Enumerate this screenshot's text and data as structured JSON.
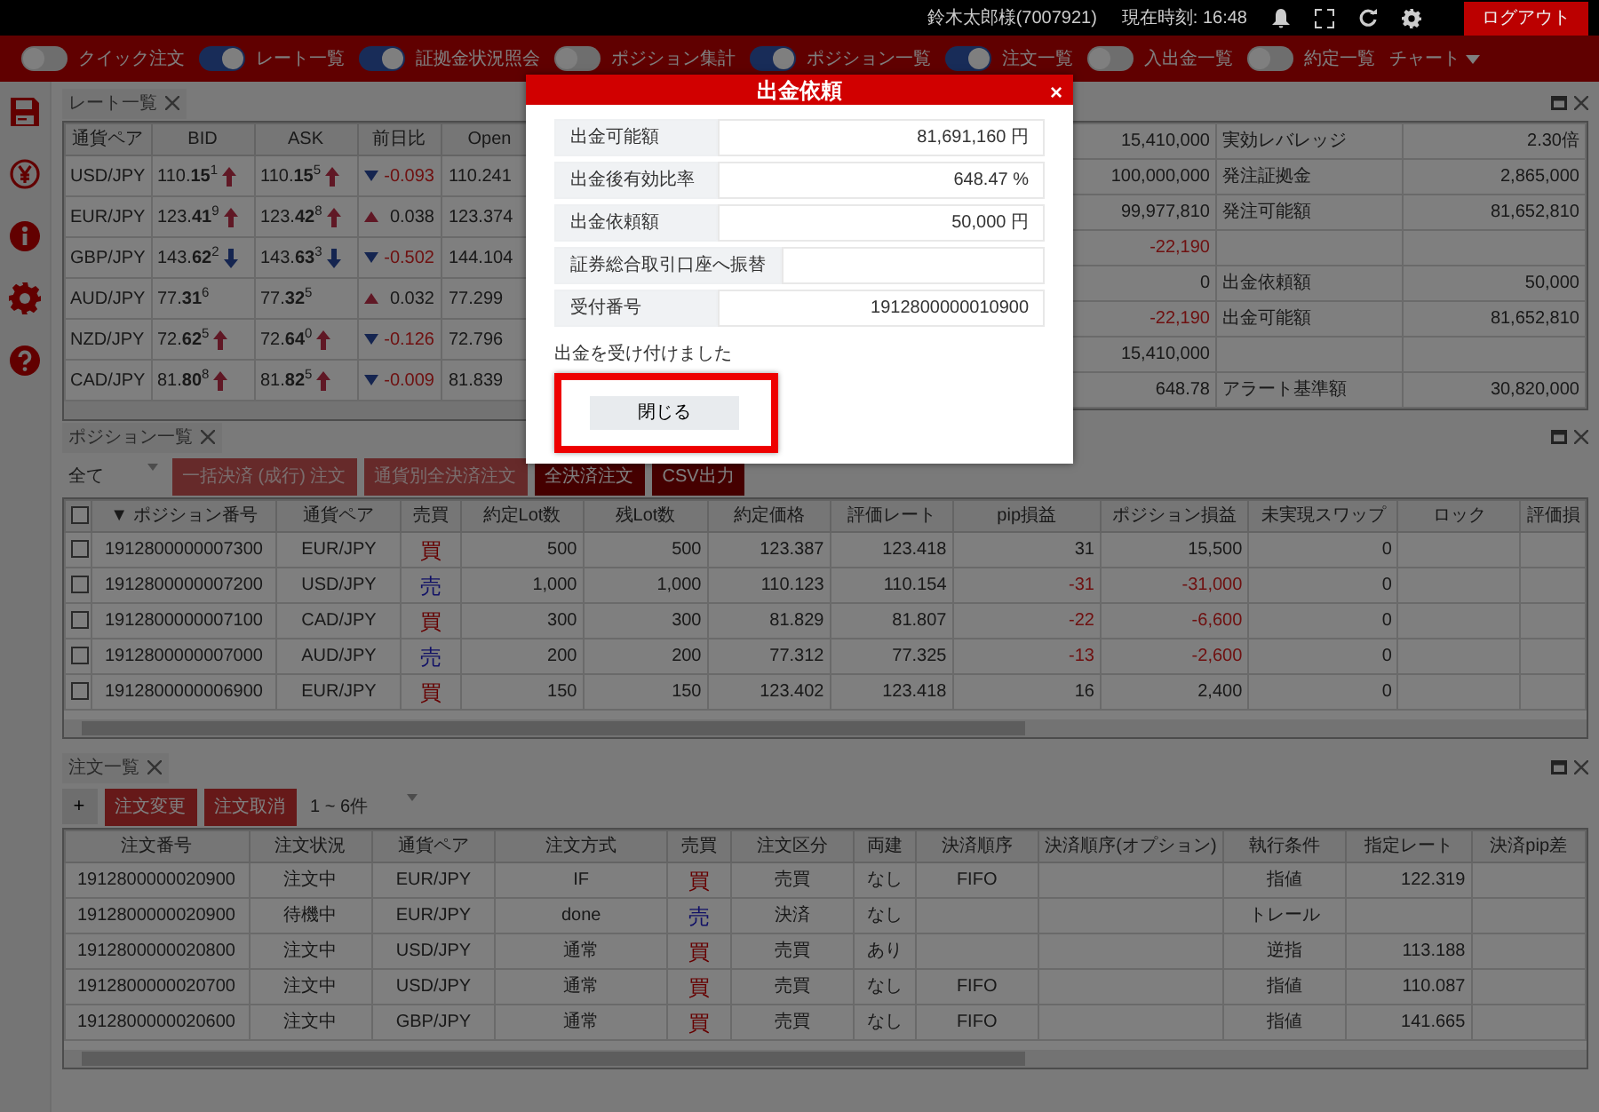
{
  "top_bar": {
    "user": "鈴木太郎様(7007921)",
    "clock": "現在時刻: 16:48",
    "logout": "ログアウト"
  },
  "toolbar": {
    "toggles": [
      {
        "label": "クイック注文",
        "on": false
      },
      {
        "label": "レート一覧",
        "on": true
      },
      {
        "label": "証拠金状況照会",
        "on": true
      },
      {
        "label": "ポジション集計",
        "on": false
      },
      {
        "label": "ポジション一覧",
        "on": true
      },
      {
        "label": "注文一覧",
        "on": true
      },
      {
        "label": "入出金一覧",
        "on": false
      },
      {
        "label": "約定一覧",
        "on": false
      }
    ],
    "menu": "チャート"
  },
  "rate_panel": {
    "tab": "レート一覧",
    "columns": [
      "通貨ペア",
      "BID",
      "ASK",
      "前日比",
      "Open"
    ],
    "rows": [
      {
        "pair": "USD/JPY",
        "bid": {
          "text": "110.**15**$^{1}$",
          "kind": "up"
        },
        "ask": {
          "text": "110.**15**$^{5}$",
          "kind": "up"
        },
        "change": {
          "text": "-0.093",
          "kind": "down"
        },
        "open": "110.241"
      },
      {
        "pair": "EUR/JPY",
        "bid": {
          "text": "123.**41**$^{9}$",
          "kind": "up"
        },
        "ask": {
          "text": "123.**42**$^{8}$",
          "kind": "up"
        },
        "change": {
          "text": "0.038",
          "kind": "up"
        },
        "open": "123.374"
      },
      {
        "pair": "GBP/JPY",
        "bid": {
          "text": "143.**62**$^{2}$",
          "kind": "down"
        },
        "ask": {
          "text": "143.**63**$^{3}$",
          "kind": "down"
        },
        "change": {
          "text": "-0.502",
          "kind": "down"
        },
        "open": "144.104"
      },
      {
        "pair": "AUD/JPY",
        "bid": {
          "text": "77.**31**$^{6}$",
          "kind": "flat"
        },
        "ask": {
          "text": "77.**32**$^{5}$",
          "kind": "flat"
        },
        "change": {
          "text": "0.032",
          "kind": "up"
        },
        "open": "77.299"
      },
      {
        "pair": "NZD/JPY",
        "bid": {
          "text": "72.**62**$^{5}$",
          "kind": "up"
        },
        "ask": {
          "text": "72.**64**$^{0}$",
          "kind": "up"
        },
        "change": {
          "text": "-0.126",
          "kind": "down"
        },
        "open": "72.796"
      },
      {
        "pair": "CAD/JPY",
        "bid": {
          "text": "81.**80**$^{8}$",
          "kind": "up"
        },
        "ask": {
          "text": "81.**82**$^{5}$",
          "kind": "up"
        },
        "change": {
          "text": "-0.009",
          "kind": "down"
        },
        "open": "81.839"
      }
    ]
  },
  "margin_panel": {
    "rows": [
      {
        "value": "15,410,000",
        "loss": false,
        "label": "実効レバレッジ",
        "value_2": "2.30倍"
      },
      {
        "value": "100,000,000",
        "loss": false,
        "label": "発注証拠金",
        "value_2": "2,865,000"
      },
      {
        "value": "99,977,810",
        "loss": false,
        "label": "発注可能額",
        "value_2": "81,652,810"
      },
      {
        "value": "-22,190",
        "loss": true
      },
      {
        "value": "0",
        "loss": false,
        "label": "出金依頼額",
        "value_2": "50,000"
      },
      {
        "value": "-22,190",
        "loss": true,
        "label": "出金可能額",
        "value_2": "81,652,810"
      },
      {
        "value": "15,410,000",
        "loss": false
      },
      {
        "value": "648.78",
        "loss": false,
        "label": "アラート基準額",
        "value_2": "30,820,000"
      }
    ]
  },
  "position_panel": {
    "tab": "ポジション一覧",
    "filter": "全て",
    "buttons": [
      {
        "label": "一括決済 (成行) 注文",
        "disabled": true
      },
      {
        "label": "通貨別全決済注文",
        "disabled": true
      },
      {
        "label": "全決済注文",
        "disabled": false
      },
      {
        "label": "CSV出力",
        "disabled": false
      }
    ],
    "select_all_checked": false,
    "columns": [
      "▼ ポジション番号",
      "通貨ペア",
      "売買",
      "約定Lot数",
      "残Lot数",
      "約定価格",
      "評価レート",
      "pip損益",
      "ポジション損益",
      "未実現スワップ",
      "ロック",
      "評価損"
    ],
    "rows": [
      {
        "checked": false,
        "number": "1912800000007300",
        "pair": "EUR/JPY",
        "side": {
          "text": "買",
          "kind": "buy"
        },
        "lots": "500",
        "remaining": "500",
        "price": "123.387",
        "rate": "123.418",
        "pips": "31",
        "pnl": "15,500",
        "loss": false,
        "swap": "0"
      },
      {
        "checked": false,
        "number": "1912800000007200",
        "pair": "USD/JPY",
        "side": {
          "text": "売",
          "kind": "sell"
        },
        "lots": "1,000",
        "remaining": "1,000",
        "price": "110.123",
        "rate": "110.154",
        "pips": "-31",
        "pnl": "-31,000",
        "loss": true,
        "swap": "0"
      },
      {
        "checked": false,
        "number": "1912800000007100",
        "pair": "CAD/JPY",
        "side": {
          "text": "買",
          "kind": "buy"
        },
        "lots": "300",
        "remaining": "300",
        "price": "81.829",
        "rate": "81.807",
        "pips": "-22",
        "pnl": "-6,600",
        "loss": true,
        "swap": "0"
      },
      {
        "checked": false,
        "number": "1912800000007000",
        "pair": "AUD/JPY",
        "side": {
          "text": "売",
          "kind": "sell"
        },
        "lots": "200",
        "remaining": "200",
        "price": "77.312",
        "rate": "77.325",
        "pips": "-13",
        "pnl": "-2,600",
        "loss": true,
        "swap": "0"
      },
      {
        "checked": false,
        "number": "1912800000006900",
        "pair": "EUR/JPY",
        "side": {
          "text": "買",
          "kind": "buy"
        },
        "lots": "150",
        "remaining": "150",
        "price": "123.402",
        "rate": "123.418",
        "pips": "16",
        "pnl": "2,400",
        "loss": false,
        "swap": "0"
      }
    ]
  },
  "order_panel": {
    "tab": "注文一覧",
    "add": "+",
    "buttons": [
      "注文変更",
      "注文取消"
    ],
    "range": "1 ~ 6件",
    "columns": [
      "注文番号",
      "注文状況",
      "通貨ペア",
      "注文方式",
      "売買",
      "注文区分",
      "両建",
      "決済順序",
      "決済順序(オプション)",
      "執行条件",
      "指定レート",
      "決済pip差"
    ],
    "rows": [
      {
        "number": "1912800000020900",
        "status": "注文中",
        "pair": "EUR/JPY",
        "method": "IF",
        "side": {
          "text": "買",
          "kind": "buy"
        },
        "type": "売買",
        "hedge": "なし",
        "order": "FIFO",
        "condition": "指値",
        "rate": "122.319"
      },
      {
        "number": "1912800000020900",
        "status": "待機中",
        "pair": "EUR/JPY",
        "method": "done",
        "side": {
          "text": "売",
          "kind": "sell"
        },
        "type": "決済",
        "hedge": "なし",
        "condition": "トレール"
      },
      {
        "number": "1912800000020800",
        "status": "注文中",
        "pair": "USD/JPY",
        "method": "通常",
        "side": {
          "text": "買",
          "kind": "buy"
        },
        "type": "売買",
        "hedge": "あり",
        "condition": "逆指",
        "rate": "113.188"
      },
      {
        "number": "1912800000020700",
        "status": "注文中",
        "pair": "USD/JPY",
        "method": "通常",
        "side": {
          "text": "買",
          "kind": "buy"
        },
        "type": "売買",
        "hedge": "なし",
        "order": "FIFO",
        "condition": "指値",
        "rate": "110.087"
      },
      {
        "number": "1912800000020600",
        "status": "注文中",
        "pair": "GBP/JPY",
        "method": "通常",
        "side": {
          "text": "買",
          "kind": "buy"
        },
        "type": "売買",
        "hedge": "なし",
        "order": "FIFO",
        "condition": "指値",
        "rate": "141.665"
      }
    ]
  },
  "dialog": {
    "title": "出金依頼",
    "close": "×",
    "fields": [
      {
        "label": "出金可能額",
        "value": "81,691,160 円"
      },
      {
        "label": "出金後有効比率",
        "value": "648.47 %"
      },
      {
        "label": "出金依頼額",
        "value": "50,000 円"
      },
      {
        "label": "証券総合取引口座へ振替"
      },
      {
        "label": "受付番号",
        "value": "1912800000010900"
      }
    ],
    "message": "出金を受け付けました",
    "button": {
      "label": "閉じる",
      "highlighted": true
    }
  }
}
